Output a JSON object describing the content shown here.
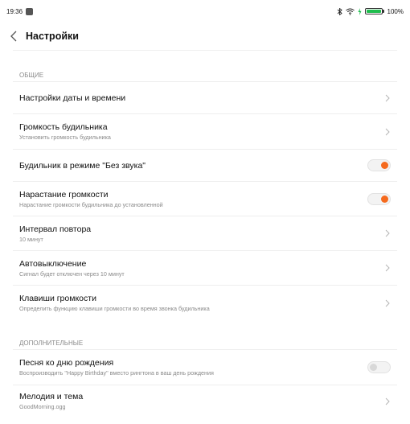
{
  "status_bar": {
    "time": "19:36",
    "battery": "100%",
    "battery_level": 1.0,
    "icons": [
      "bluetooth-icon",
      "wifi-icon",
      "charging-icon",
      "battery-icon"
    ]
  },
  "header": {
    "title": "Настройки",
    "back_icon": "chevron-left-icon"
  },
  "sections": {
    "general": "ОБЩИЕ",
    "additional": "ДОПОЛНИТЕЛЬНЫЕ"
  },
  "items": [
    {
      "title": "Настройки даты и времени",
      "subtitle": "",
      "control": "chevron"
    },
    {
      "title": "Громкость будильника",
      "subtitle": "Установить громкость будильника",
      "control": "chevron"
    },
    {
      "title": "Будильник в режиме \"Без звука\"",
      "subtitle": "",
      "control": "toggle",
      "on": true
    },
    {
      "title": "Нарастание громкости",
      "subtitle": "Нарастание громкости будильника до установленной",
      "control": "toggle",
      "on": true
    },
    {
      "title": "Интервал повтора",
      "subtitle": "10 минут",
      "control": "chevron"
    },
    {
      "title": "Автовыключение",
      "subtitle": "Сигнал будет отключен через 10 минут",
      "control": "chevron"
    },
    {
      "title": "Клавиши громкости",
      "subtitle": "Определить функцию клавиши громкости во время звонка будильника",
      "control": "chevron"
    }
  ],
  "additional_items": [
    {
      "title": "Песня ко дню рождения",
      "subtitle": "Воспроизводить \"Happy Birthday\" вместо рингтона в ваш день рождения",
      "control": "toggle",
      "on": false
    },
    {
      "title": "Мелодия и тема",
      "subtitle": "GoodMorning.ogg",
      "control": "chevron"
    }
  ],
  "colors": {
    "accent": "#f56a1e",
    "battery": "#1fbd4e",
    "secondary_text": "#8a8a8a"
  }
}
